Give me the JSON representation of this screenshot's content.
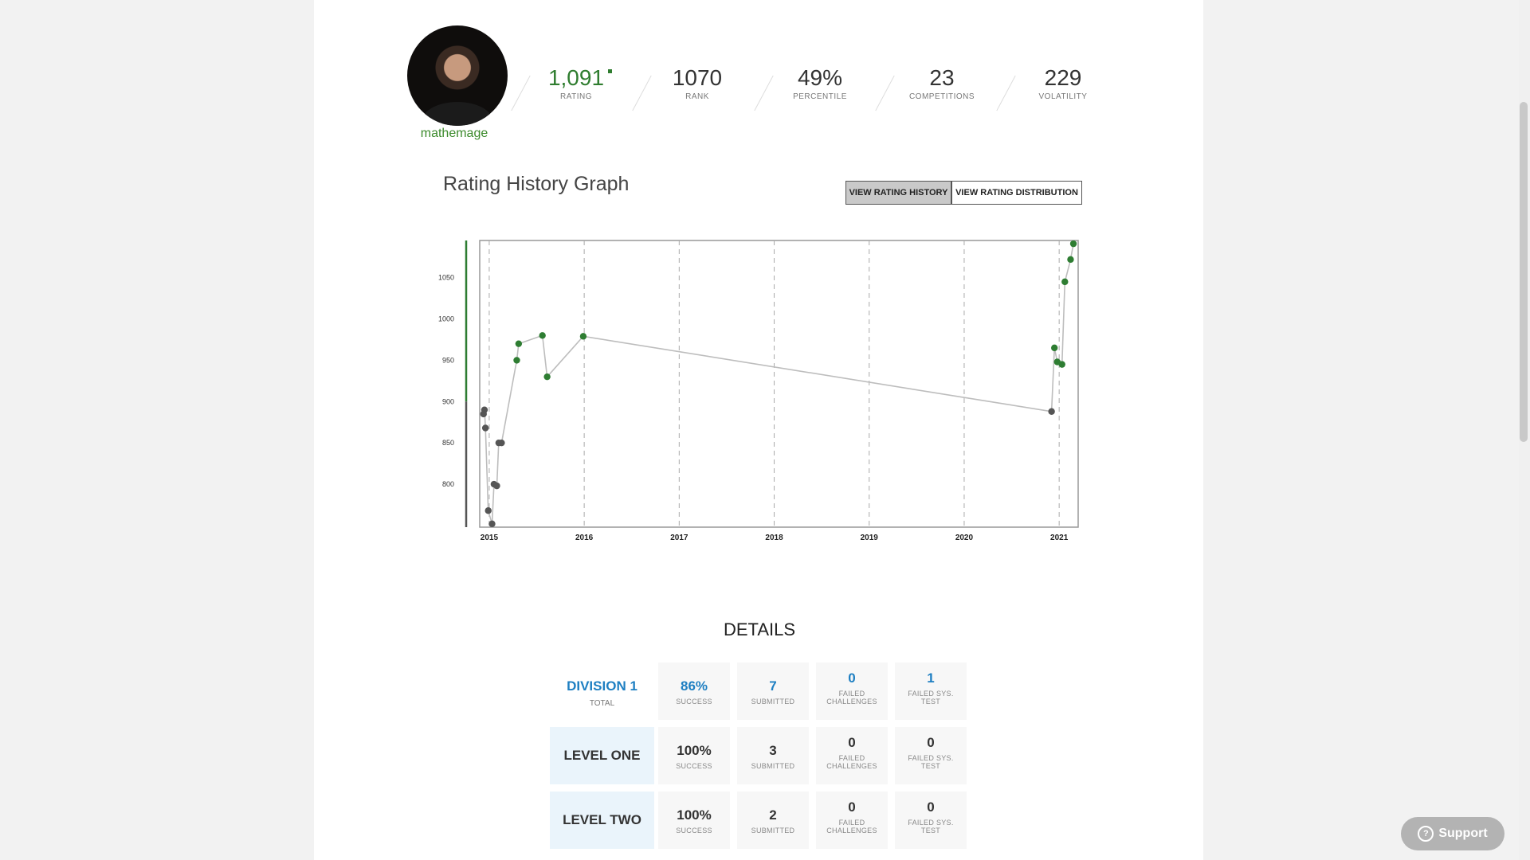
{
  "profile": {
    "handle": "mathemage",
    "avatar_alt": "avatar"
  },
  "stats": [
    {
      "key": "rating",
      "value": "1,091",
      "label": "RATING"
    },
    {
      "key": "rank",
      "value": "1070",
      "label": "RANK"
    },
    {
      "key": "percentile",
      "value": "49%",
      "label": "PERCENTILE"
    },
    {
      "key": "competitions",
      "value": "23",
      "label": "COMPETITIONS"
    },
    {
      "key": "volatility",
      "value": "229",
      "label": "VOLATILITY"
    }
  ],
  "graph": {
    "title": "Rating History Graph",
    "buttons": [
      "VIEW RATING HISTORY",
      "VIEW RATING DISTRIBUTION"
    ],
    "active_button": 0
  },
  "chart_data": {
    "type": "line",
    "title": "Rating History Graph",
    "xlabel": "",
    "ylabel": "",
    "x_ticks": [
      "2015",
      "2016",
      "2017",
      "2018",
      "2019",
      "2020",
      "2021"
    ],
    "y_ticks": [
      800,
      850,
      900,
      950,
      1000,
      1050
    ],
    "xlim": [
      2014.9,
      2021.2
    ],
    "ylim": [
      748,
      1095
    ],
    "colors": {
      "gray": "#555555",
      "green": "#2e7d32",
      "line": "#bdbdbd",
      "border": "#999999"
    },
    "series": [
      {
        "points": [
          {
            "x": 2014.94,
            "y": 885
          },
          {
            "x": 2014.95,
            "y": 890
          },
          {
            "x": 2014.96,
            "y": 868
          },
          {
            "x": 2014.99,
            "y": 768
          },
          {
            "x": 2015.03,
            "y": 752
          },
          {
            "x": 2015.05,
            "y": 800
          },
          {
            "x": 2015.08,
            "y": 798
          },
          {
            "x": 2015.1,
            "y": 850
          },
          {
            "x": 2015.13,
            "y": 850
          },
          {
            "x": 2015.29,
            "y": 950
          },
          {
            "x": 2015.31,
            "y": 970
          },
          {
            "x": 2015.56,
            "y": 980
          },
          {
            "x": 2015.61,
            "y": 930
          },
          {
            "x": 2015.99,
            "y": 979
          },
          {
            "x": 2020.92,
            "y": 888
          },
          {
            "x": 2020.95,
            "y": 965
          },
          {
            "x": 2020.98,
            "y": 948
          },
          {
            "x": 2021.03,
            "y": 945
          },
          {
            "x": 2021.06,
            "y": 1045
          },
          {
            "x": 2021.12,
            "y": 1072
          },
          {
            "x": 2021.15,
            "y": 1091
          }
        ]
      }
    ]
  },
  "details": {
    "title": "DETAILS",
    "rows": [
      {
        "name": "DIVISION 1",
        "sub": "TOTAL",
        "success": "86%",
        "submitted": "7",
        "failed_challenges": "0",
        "failed_sys": "1"
      },
      {
        "name": "LEVEL ONE",
        "sub": "",
        "success": "100%",
        "submitted": "3",
        "failed_challenges": "0",
        "failed_sys": "0"
      },
      {
        "name": "LEVEL TWO",
        "sub": "",
        "success": "100%",
        "submitted": "2",
        "failed_challenges": "0",
        "failed_sys": "0"
      }
    ],
    "labels": {
      "success": "SUCCESS",
      "submitted": "SUBMITTED",
      "failed_challenges_1": "FAILED",
      "failed_challenges_2": "CHALLENGES",
      "failed_sys_1": "FAILED SYS.",
      "failed_sys_2": "TEST"
    }
  },
  "support": {
    "label": "Support"
  }
}
